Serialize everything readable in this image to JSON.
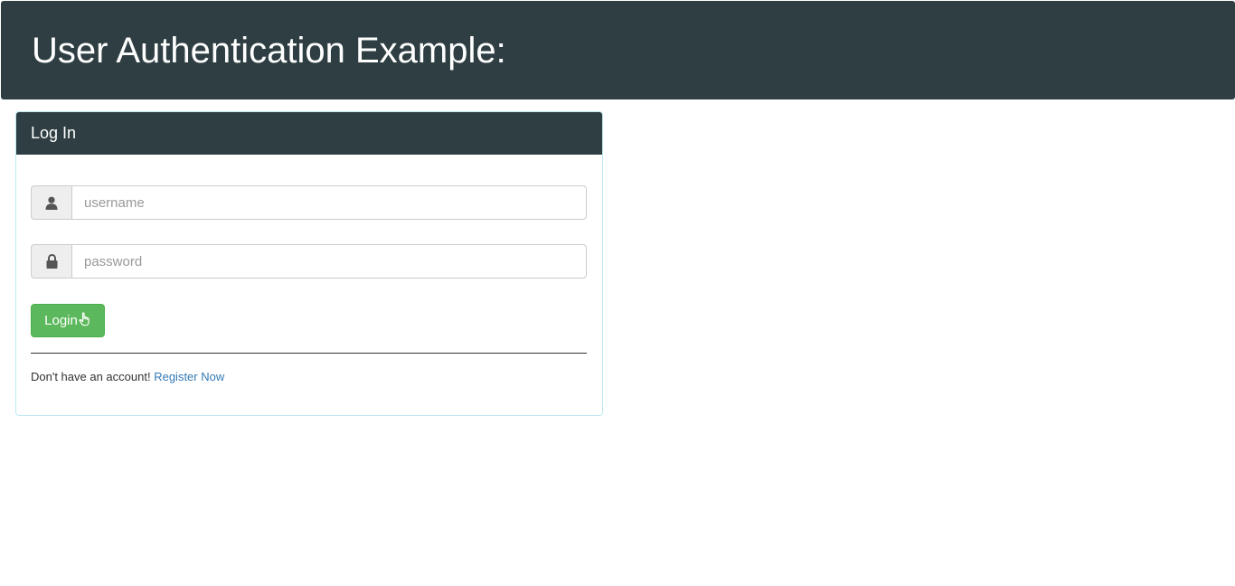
{
  "header": {
    "title": "User Authentication Example:"
  },
  "login_panel": {
    "heading": "Log In",
    "username": {
      "placeholder": "username",
      "value": "",
      "icon": "user-icon"
    },
    "password": {
      "placeholder": "password",
      "value": "",
      "icon": "lock-icon"
    },
    "login_button": {
      "label": "Login",
      "icon": "hand-pointer-icon"
    },
    "footer": {
      "text": "Don't have an account!",
      "link_label": "Register Now"
    }
  },
  "colors": {
    "header_bg": "#2e3e42",
    "button_bg": "#5cb85c",
    "link": "#337ab7",
    "panel_border": "#bce8f1"
  }
}
